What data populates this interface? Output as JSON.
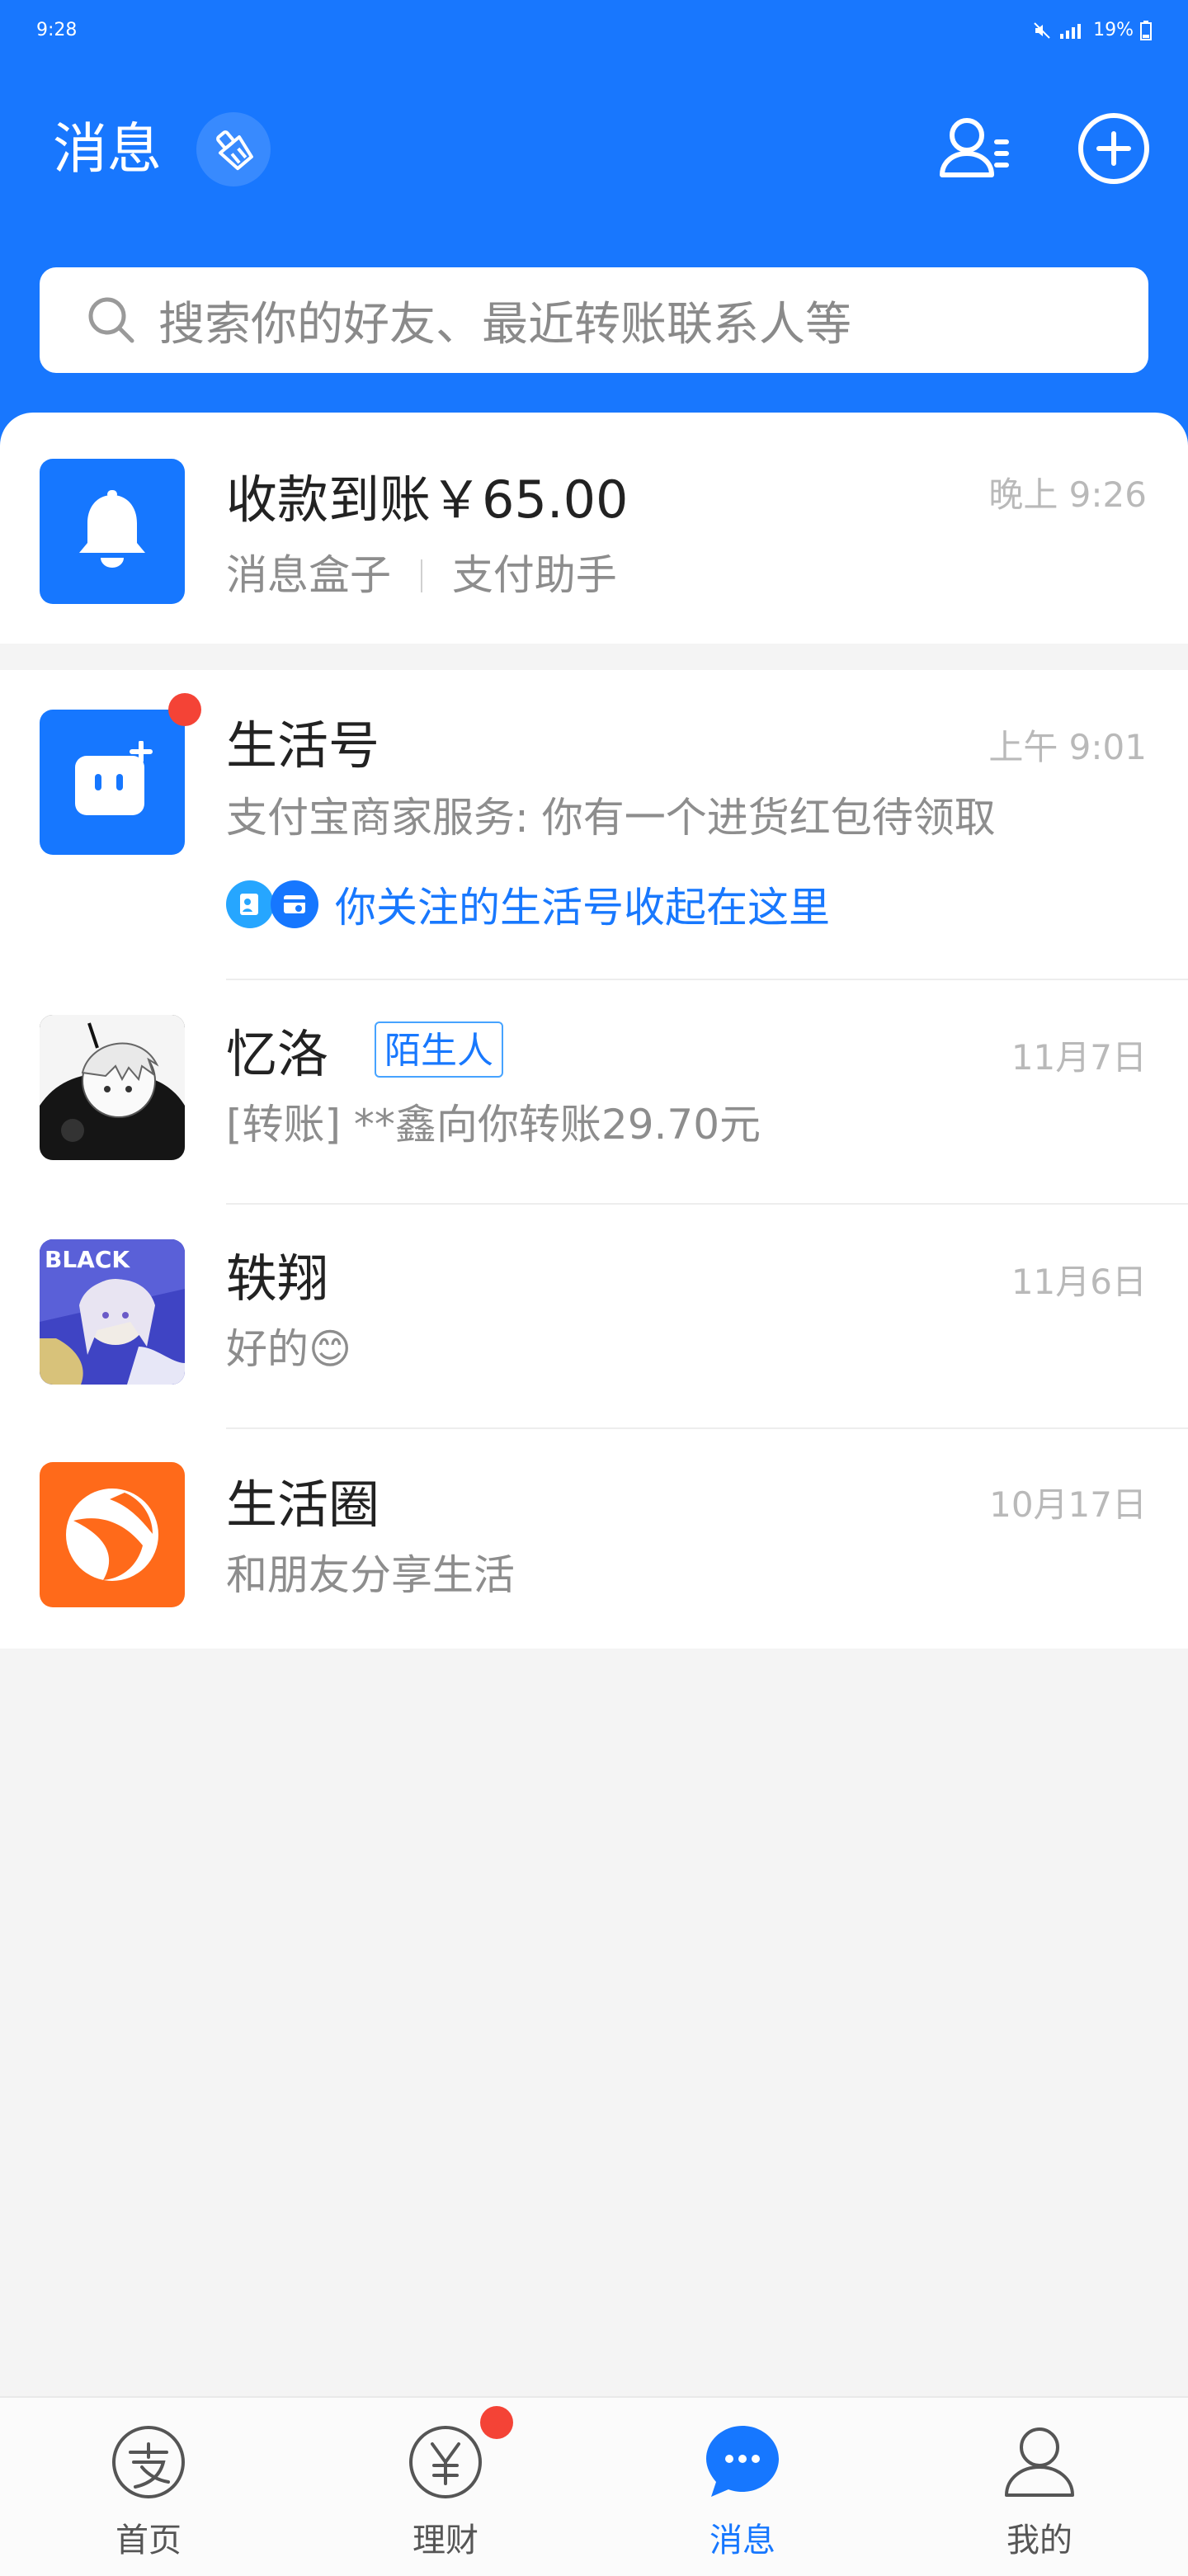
{
  "status_bar": {
    "time": "9:28",
    "battery": "19%"
  },
  "header": {
    "title": "消息",
    "search_placeholder": "搜索你的好友、最近转账联系人等"
  },
  "messages": [
    {
      "title": "收款到账￥65.00",
      "source": "消息盒子",
      "source2": "支付助手",
      "time": "晚上 9:26"
    },
    {
      "title": "生活号",
      "subtitle": "支付宝商家服务: 你有一个进货红包待领取",
      "link_text": "你关注的生活号收起在这里",
      "time": "上午 9:01"
    },
    {
      "title": "忆洛",
      "tag": "陌生人",
      "subtitle": "[转账] **鑫向你转账29.70元",
      "time": "11月7日"
    },
    {
      "title": "轶翔",
      "subtitle": "好的😊",
      "time": "11月6日"
    },
    {
      "title": "生活圈",
      "subtitle": "和朋友分享生活",
      "time": "10月17日"
    }
  ],
  "tabs": [
    {
      "label": "首页"
    },
    {
      "label": "理财"
    },
    {
      "label": "消息"
    },
    {
      "label": "我的"
    }
  ],
  "colors": {
    "brand_blue": "#1877fe",
    "badge_red": "#f44336"
  }
}
